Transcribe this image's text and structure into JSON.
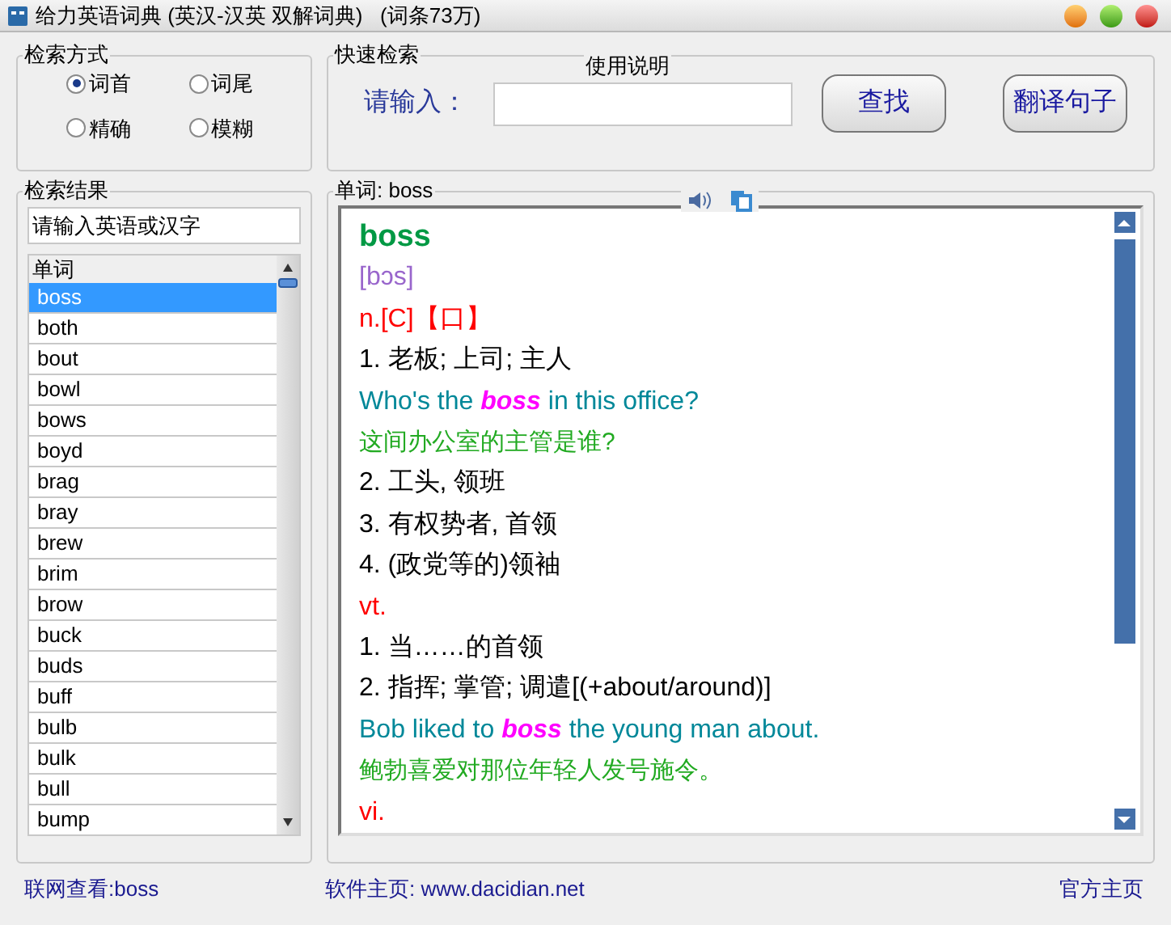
{
  "window": {
    "title": "给力英语词典 (英汉-汉英 双解词典)   (词条73万)"
  },
  "search_mode": {
    "title": "检索方式",
    "options": [
      {
        "label": "词首",
        "selected": true
      },
      {
        "label": "词尾",
        "selected": false
      },
      {
        "label": "精确",
        "selected": false
      },
      {
        "label": "模糊",
        "selected": false
      }
    ]
  },
  "quick_search": {
    "title": "快速检索",
    "help_link": "使用说明",
    "prompt": "请输入：",
    "find_button": "查找",
    "translate_button": "翻译句子"
  },
  "results": {
    "title": "检索结果",
    "filter_value": "请输入英语或汉字",
    "column": "单词",
    "rows": [
      {
        "word": "boss",
        "selected": true
      },
      {
        "word": "both",
        "selected": false
      },
      {
        "word": "bout",
        "selected": false
      },
      {
        "word": "bowl",
        "selected": false
      },
      {
        "word": "bows",
        "selected": false
      },
      {
        "word": "boyd",
        "selected": false
      },
      {
        "word": "brag",
        "selected": false
      },
      {
        "word": "bray",
        "selected": false
      },
      {
        "word": "brew",
        "selected": false
      },
      {
        "word": "brim",
        "selected": false
      },
      {
        "word": "brow",
        "selected": false
      },
      {
        "word": "buck",
        "selected": false
      },
      {
        "word": "buds",
        "selected": false
      },
      {
        "word": "buff",
        "selected": false
      },
      {
        "word": "bulb",
        "selected": false
      },
      {
        "word": "bulk",
        "selected": false
      },
      {
        "word": "bull",
        "selected": false
      },
      {
        "word": "bump",
        "selected": false
      }
    ]
  },
  "definition": {
    "title": "单词: boss",
    "lines": [
      {
        "kind": "headword",
        "text": "boss"
      },
      {
        "kind": "phonetic",
        "text": "[bɔs]"
      },
      {
        "kind": "pos",
        "text": "n.[C]【口】"
      },
      {
        "kind": "sense",
        "text": "1. 老板; 上司; 主人"
      },
      {
        "kind": "example",
        "text": "Who's the **boss** in this office?"
      },
      {
        "kind": "translation",
        "text": "这间办公室的主管是谁?"
      },
      {
        "kind": "sense",
        "text": "2. 工头, 领班"
      },
      {
        "kind": "sense",
        "text": "3. 有权势者, 首领"
      },
      {
        "kind": "sense",
        "text": "4. (政党等的)领袖"
      },
      {
        "kind": "pos",
        "text": "vt."
      },
      {
        "kind": "sense",
        "text": "1. 当……的首领"
      },
      {
        "kind": "sense",
        "text": "2. 指挥; 掌管; 调遣[(+about/around)]"
      },
      {
        "kind": "example",
        "text": "Bob liked to **boss** the young man about."
      },
      {
        "kind": "translation",
        "text": "鲍勃喜爱对那位年轻人发号施令。"
      },
      {
        "kind": "pos",
        "text": "vi."
      }
    ]
  },
  "status_bar": {
    "online": "联网查看:boss",
    "homepage": "软件主页: www.dacidian.net",
    "official": "官方主页"
  }
}
